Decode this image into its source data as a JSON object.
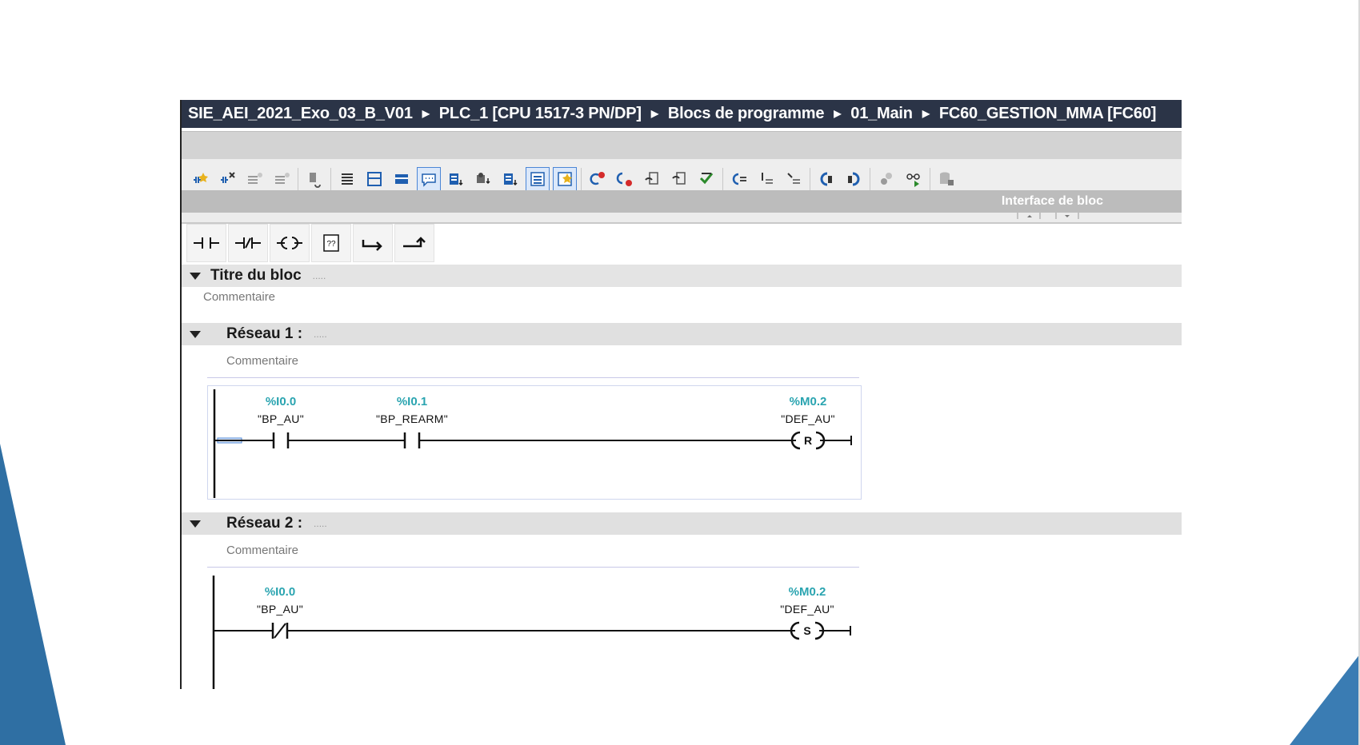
{
  "breadcrumb": {
    "project": "SIE_AEI_2021_Exo_03_B_V01",
    "plc": "PLC_1 [CPU 1517-3 PN/DP]",
    "folder": "Blocs de programme",
    "group": "01_Main",
    "block": "FC60_GESTION_MMA [FC60]",
    "separator_icon": "triangle-right-icon"
  },
  "toolbar": {
    "interface_label": "Interface de bloc"
  },
  "instructions": {
    "contact_no": "contact-no-icon",
    "contact_nc": "contact-nc-icon",
    "coil": "coil-icon",
    "empty_box": "empty-box-icon",
    "open_branch": "open-branch-icon",
    "close_branch": "close-branch-icon",
    "empty_box_label": "??"
  },
  "block": {
    "title": "Titre du bloc",
    "title_dots": ".....",
    "comment": "Commentaire"
  },
  "networks": [
    {
      "title": "Réseau 1 :",
      "dots": ".....",
      "comment": "Commentaire",
      "contacts": [
        {
          "address": "%I0.0",
          "symbol": "\"BP_AU\"",
          "type": "NO"
        },
        {
          "address": "%I0.1",
          "symbol": "\"BP_REARM\"",
          "type": "NO"
        }
      ],
      "coil": {
        "address": "%M0.2",
        "symbol": "\"DEF_AU\"",
        "type": "R"
      }
    },
    {
      "title": "Réseau 2 :",
      "dots": ".....",
      "comment": "Commentaire",
      "contacts": [
        {
          "address": "%I0.0",
          "symbol": "\"BP_AU\"",
          "type": "NC"
        }
      ],
      "coil": {
        "address": "%M0.2",
        "symbol": "\"DEF_AU\"",
        "type": "S"
      }
    }
  ],
  "colors": {
    "crumb_bar": "#2b3447",
    "address_text": "#2aa4b0",
    "slide_accent": "#2f6fa3"
  }
}
